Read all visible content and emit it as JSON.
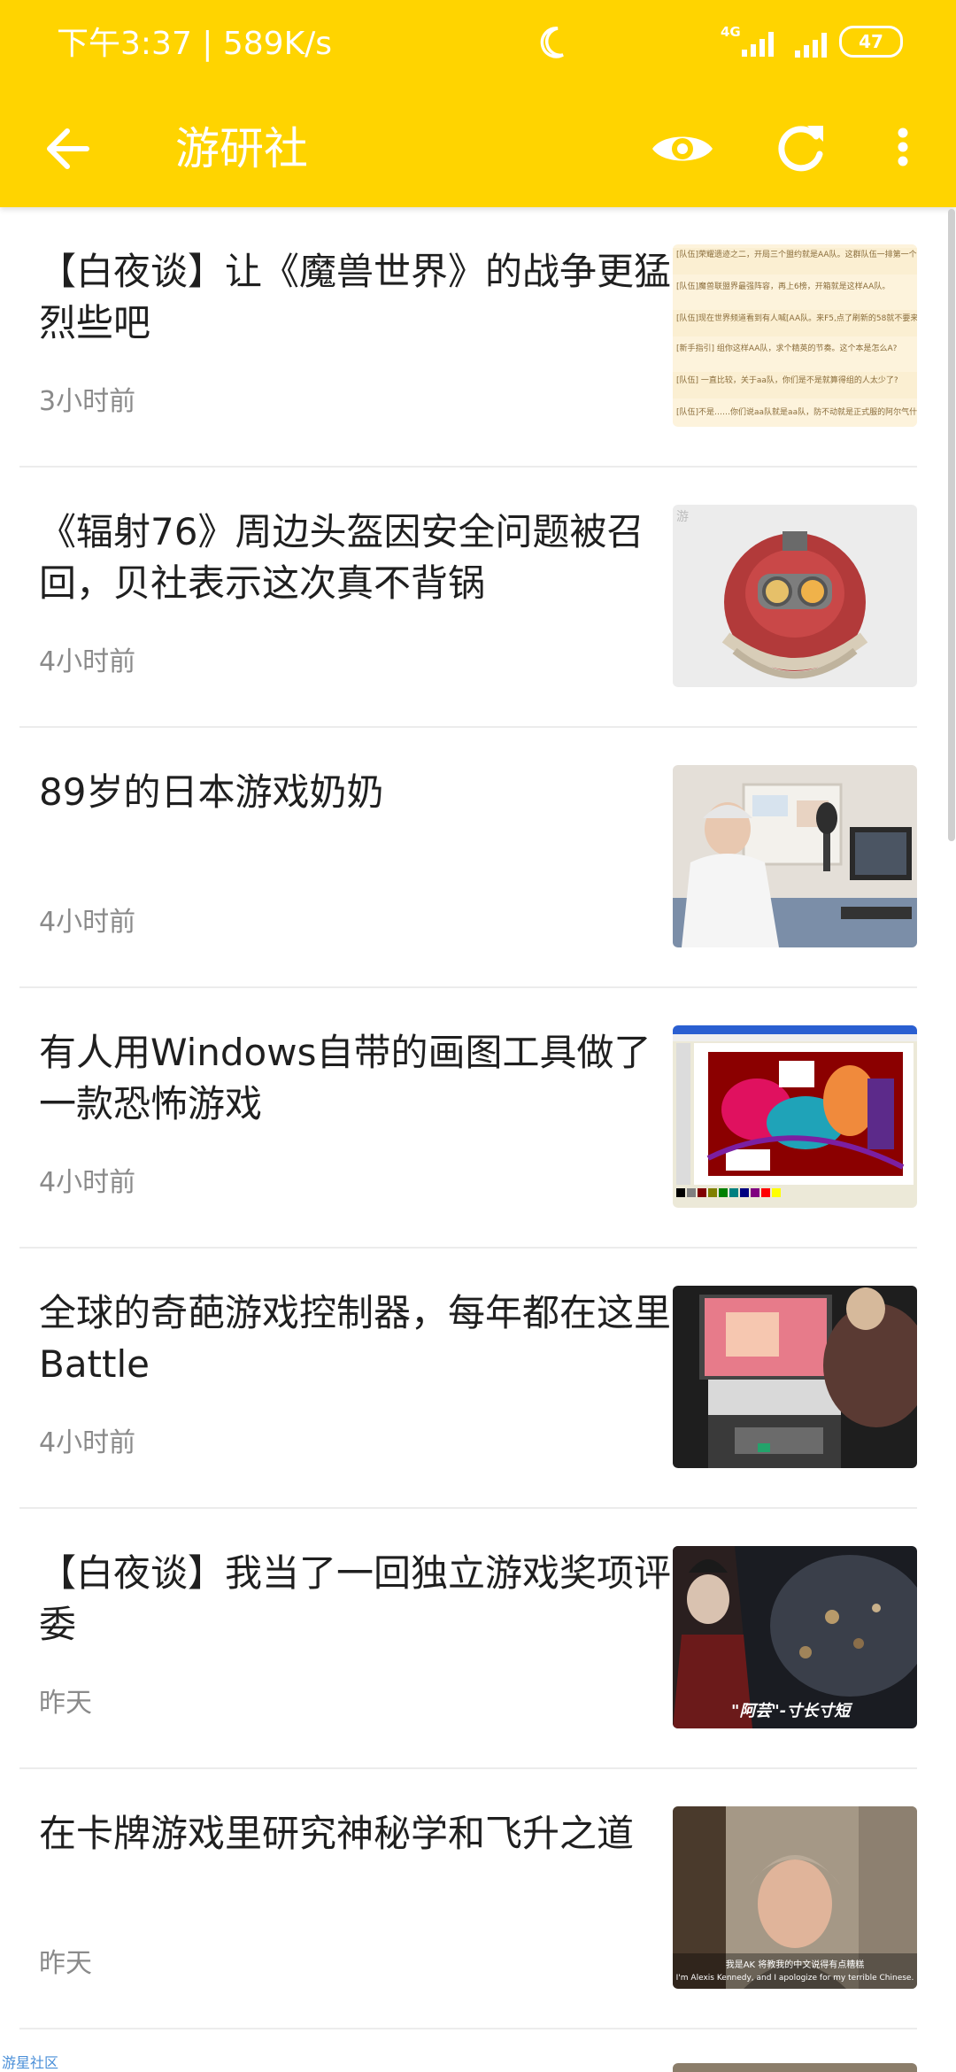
{
  "status_bar": {
    "time_speed": "下午3:37 | 589K/s",
    "network": "4G",
    "battery": "47"
  },
  "toolbar": {
    "title": "游研社",
    "icons": [
      "back-arrow-icon",
      "eye-icon",
      "refresh-icon",
      "more-vert-icon"
    ]
  },
  "articles": [
    {
      "title": "【白夜谈】让《魔兽世界》的战争更猛烈些吧",
      "time": "3小时前"
    },
    {
      "title": "《辐射76》周边头盔因安全问题被召回，贝社表示这次真不背锅",
      "time": "4小时前"
    },
    {
      "title": "89岁的日本游戏奶奶",
      "time": "4小时前"
    },
    {
      "title": "有人用Windows自带的画图工具做了一款恐怖游戏",
      "time": "4小时前"
    },
    {
      "title": "全球的奇葩游戏控制器，每年都在这里Battle",
      "time": "4小时前"
    },
    {
      "title": "【白夜谈】我当了一回独立游戏奖项评委",
      "time": "昨天"
    },
    {
      "title": "在卡牌游戏里研究神秘学和飞升之道",
      "time": "昨天"
    }
  ],
  "thumbnail_text": {
    "wow_chat": [
      "[队伍]荣耀遗迹之二，开局三个盟约就是AA队。这群队伍一排第一个一个把",
      "[队伍]魔兽联盟界最强阵容，再上6榜，开箱就是这样AA队。",
      "[队伍]现在世界频道看到有人喊[AA队。来F5,点了刷新的58就不要来了",
      "[新手指引] 组你这样AA队，求个精英的节奏。这个本是怎么A?",
      "[队伍] 一直比较，关于aa队，你们是不是就算得组的人太少了?",
      "[队伍]不是……你们说aa队就是aa队，防不动就是正式服的阿尔气什么是"
    ],
    "card_caption_cn": "我是AK 将教我的中文说得有点糟糕",
    "card_caption_en": "I'm Alexis Kennedy, and I apologize for my terrible Chinese.",
    "indie_caption": "\"阿芸\"-寸长寸短"
  },
  "footer": {
    "watermark": "游星社区"
  }
}
